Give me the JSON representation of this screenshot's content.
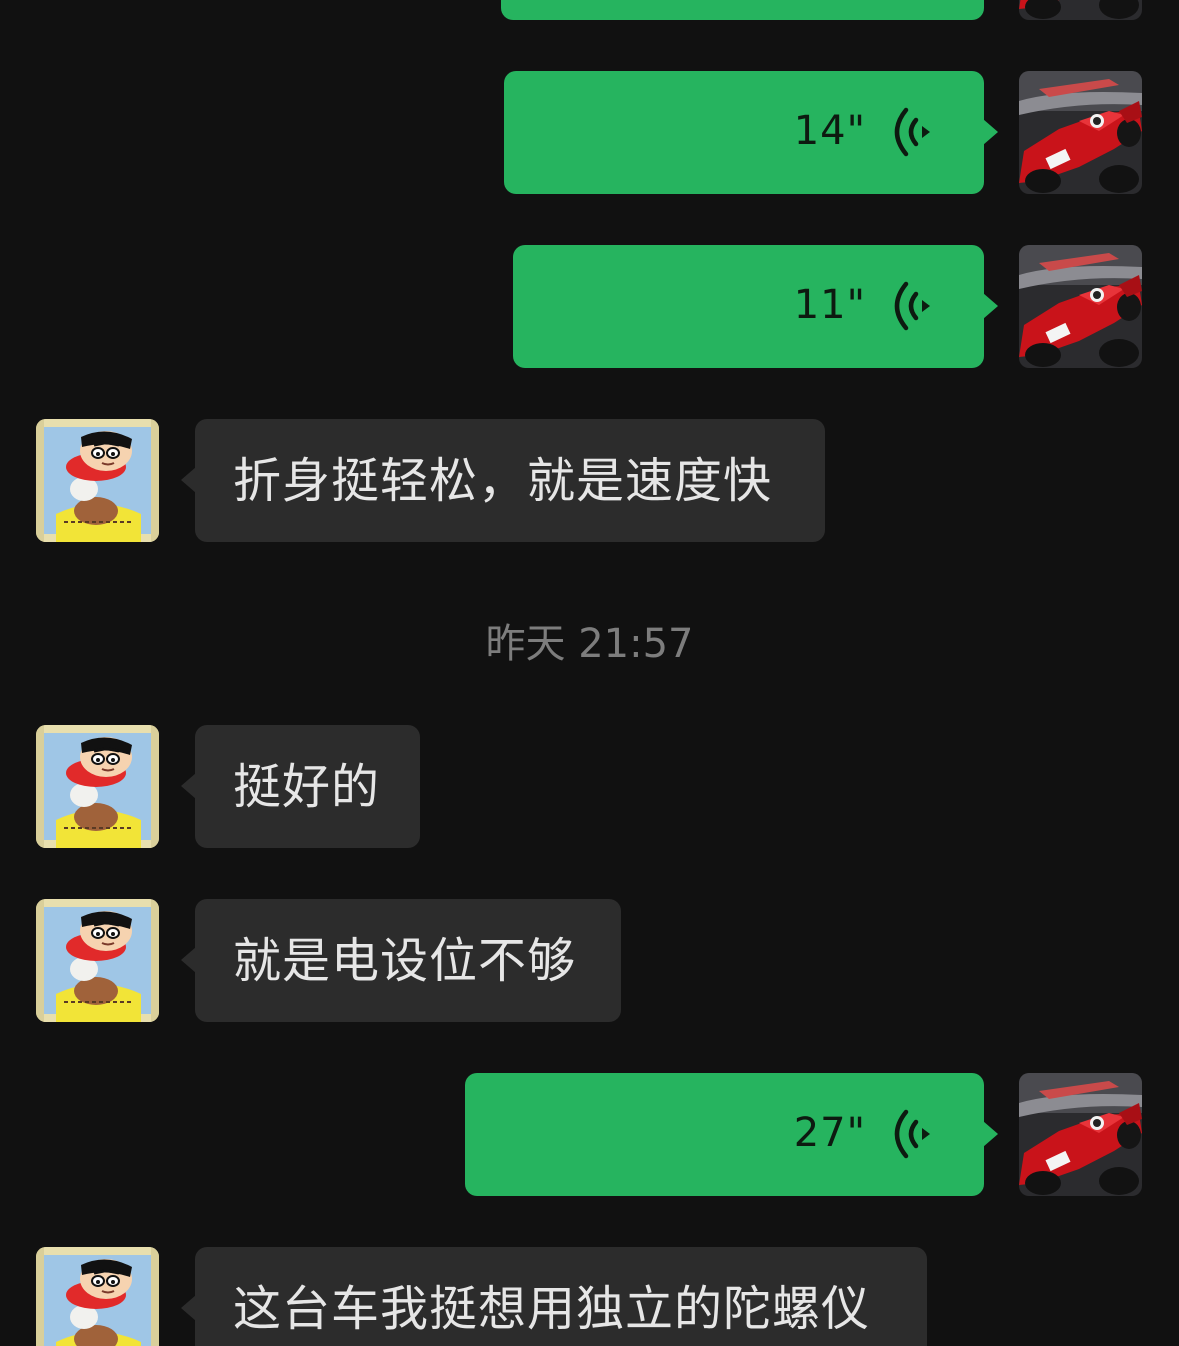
{
  "chat": {
    "timestamp": "昨天 21:57",
    "messages": [
      {
        "id": "m0",
        "from": "me",
        "type": "voice",
        "duration": ""
      },
      {
        "id": "m1",
        "from": "me",
        "type": "voice",
        "duration": "14\""
      },
      {
        "id": "m2",
        "from": "me",
        "type": "voice",
        "duration": "11\""
      },
      {
        "id": "m3",
        "from": "them",
        "type": "text",
        "text": "折身挺轻松，就是速度快"
      },
      {
        "id": "m4",
        "from": "them",
        "type": "text",
        "text": "挺好的"
      },
      {
        "id": "m5",
        "from": "them",
        "type": "text",
        "text": "就是电设位不够"
      },
      {
        "id": "m6",
        "from": "me",
        "type": "voice",
        "duration": "27\""
      },
      {
        "id": "m7",
        "from": "them",
        "type": "text",
        "text": "这台车我挺想用独立的陀螺仪"
      }
    ]
  },
  "icons": {
    "voice": "voice-wave-icon",
    "avatar_me": "race-car-avatar",
    "avatar_them": "cartoon-boy-avatar"
  },
  "colors": {
    "background": "#111111",
    "sent_bubble": "#26b45f",
    "received_bubble": "#2c2c2c",
    "received_text": "#e6e6e6",
    "timestamp_text": "#7d7d7d"
  }
}
